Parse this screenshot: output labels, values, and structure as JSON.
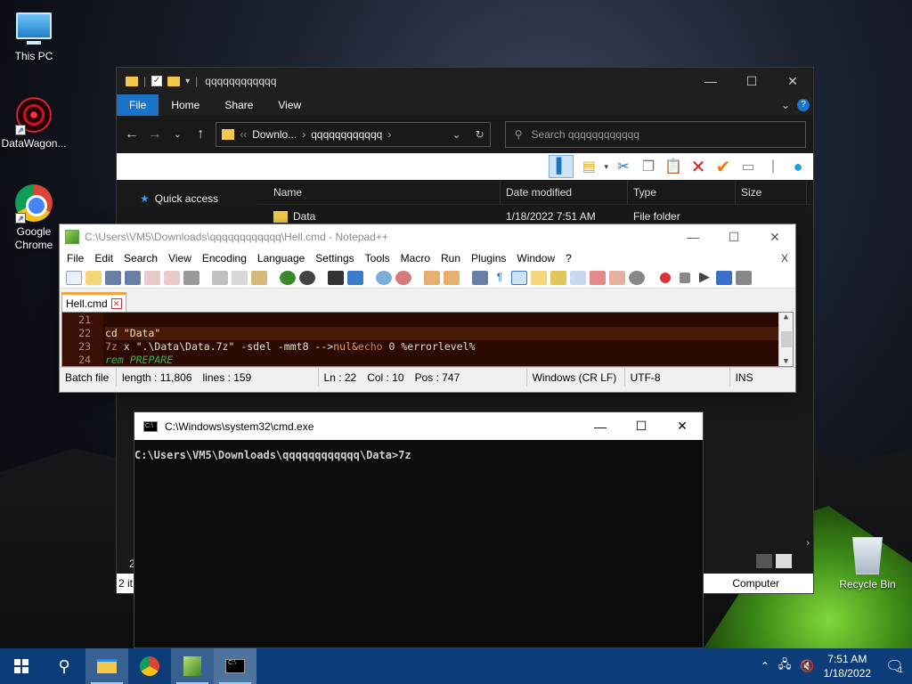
{
  "desktop": {
    "icons": [
      {
        "label": "This PC"
      },
      {
        "label": "DataWagon..."
      },
      {
        "label": "Google Chrome"
      },
      {
        "label": "Recycle Bin"
      }
    ]
  },
  "explorer": {
    "title": "qqqqqqqqqqqq",
    "tabs": [
      "File",
      "Home",
      "Share",
      "View"
    ],
    "address": {
      "seg1": "Downlo...",
      "seg2": "qqqqqqqqqqqq"
    },
    "search_placeholder": "Search qqqqqqqqqqqq",
    "nav": {
      "quick_access": "Quick access"
    },
    "columns": [
      "Name",
      "Date modified",
      "Type",
      "Size"
    ],
    "rows": [
      {
        "name": "Data",
        "date": "1/18/2022 7:51 AM",
        "type": "File folder",
        "size": ""
      }
    ],
    "status_left": "2 it",
    "status_right": "Computer",
    "count_partial": "2"
  },
  "notepadpp": {
    "title": "C:\\Users\\VM5\\Downloads\\qqqqqqqqqqqq\\Hell.cmd - Notepad++",
    "menu": [
      "File",
      "Edit",
      "Search",
      "View",
      "Encoding",
      "Language",
      "Settings",
      "Tools",
      "Macro",
      "Run",
      "Plugins",
      "Window",
      "?"
    ],
    "menu_close": "X",
    "tab": "Hell.cmd",
    "lines": [
      {
        "num": "21",
        "text": ""
      },
      {
        "num": "22",
        "text": "cd \"Data\""
      },
      {
        "num": "23",
        "cmd": "7z",
        "args": " x \".\\Data\\Data.7z\" -sdel -mmt8 -->",
        "tail1": "nul&",
        "tail2": "echo",
        "tail3": " 0 %errorlevel%"
      },
      {
        "num": "24",
        "text": "rem PREPARE"
      }
    ],
    "status": {
      "type": "Batch file",
      "length": "length : 11,806",
      "lines": "lines : 159",
      "ln": "Ln : 22",
      "col": "Col : 10",
      "pos": "Pos : 747",
      "eol": "Windows (CR LF)",
      "enc": "UTF-8",
      "mode": "INS"
    }
  },
  "cmd": {
    "title": "C:\\Windows\\system32\\cmd.exe",
    "line": "C:\\Users\\VM5\\Downloads\\qqqqqqqqqqqq\\Data>7z"
  },
  "taskbar": {
    "time": "7:51 AM",
    "date": "1/18/2022",
    "notif_count": "1"
  }
}
